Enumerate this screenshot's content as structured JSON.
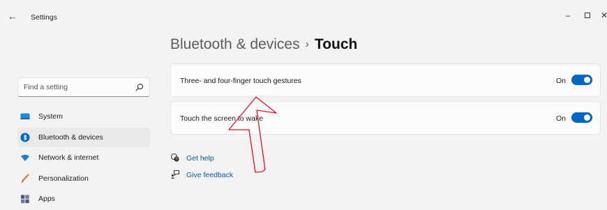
{
  "window": {
    "title": "Settings",
    "back_icon": "back-arrow-icon",
    "controls": {
      "minimize": "–",
      "close": "✕"
    }
  },
  "breadcrumb": {
    "parent": "Bluetooth & devices",
    "separator": "›",
    "current": "Touch"
  },
  "search": {
    "placeholder": "Find a setting",
    "icon": "search-icon"
  },
  "sidebar": {
    "items": [
      {
        "label": "System",
        "icon": "system-icon",
        "selected": false
      },
      {
        "label": "Bluetooth & devices",
        "icon": "bluetooth-icon",
        "selected": true
      },
      {
        "label": "Network & internet",
        "icon": "wifi-icon",
        "selected": false
      },
      {
        "label": "Personalization",
        "icon": "brush-icon",
        "selected": false
      },
      {
        "label": "Apps",
        "icon": "apps-icon",
        "selected": false
      }
    ]
  },
  "settings": [
    {
      "label": "Three- and four-finger touch gestures",
      "state": "On",
      "enabled": true
    },
    {
      "label": "Touch the screen to wake",
      "state": "On",
      "enabled": true
    }
  ],
  "links": {
    "help": "Get help",
    "feedback": "Give feedback"
  },
  "colors": {
    "accent": "#0067c0",
    "annotation": "#e81123",
    "background": "#f3f3f3",
    "card": "#fbfbfb"
  }
}
